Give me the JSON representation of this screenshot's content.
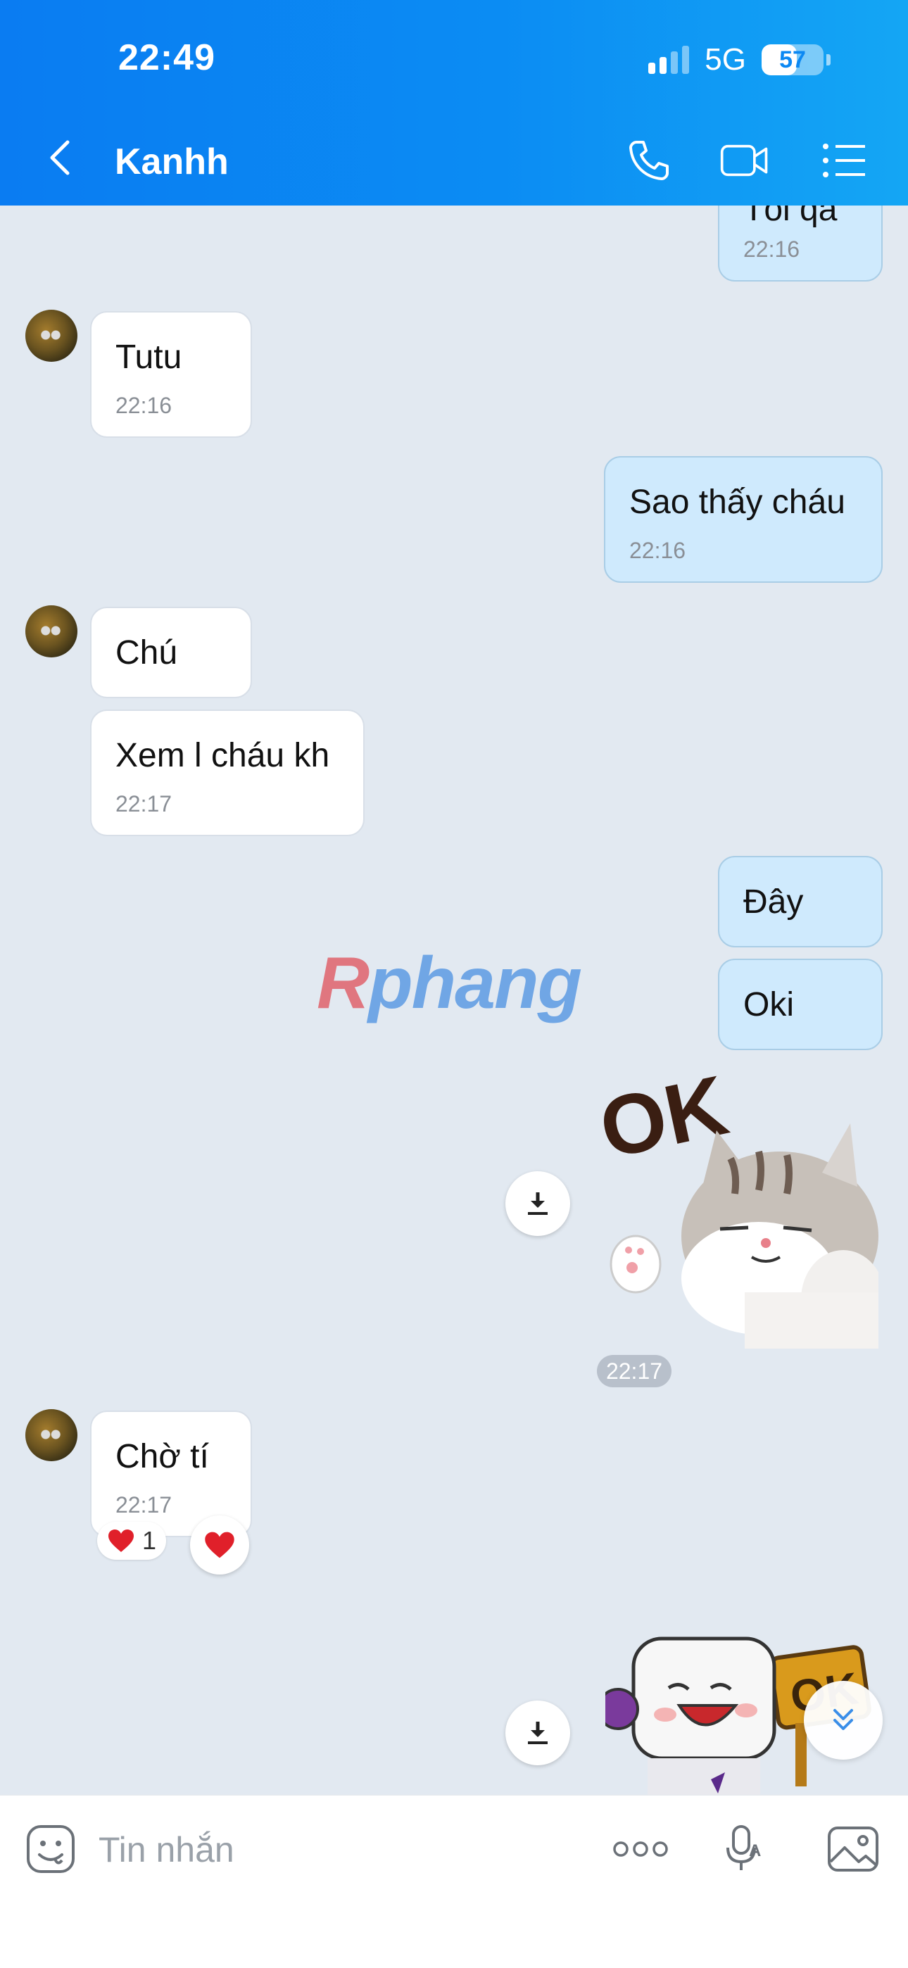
{
  "status_bar": {
    "time": "22:49",
    "network": "5G",
    "battery": "57",
    "battery_level": 0.57
  },
  "header": {
    "contact_name": "Kanhh",
    "icons": [
      "back-icon",
      "phone-icon",
      "video-call-icon",
      "menu-list-icon"
    ]
  },
  "messages": {
    "m0": {
      "text": "Tối qa",
      "time": "22:16"
    },
    "m1": {
      "text": "Tutu",
      "time": "22:16"
    },
    "m2": {
      "text": "Sao thấy cháu",
      "time": "22:16"
    },
    "m3": {
      "text": "Chú"
    },
    "m4": {
      "text": "Xem l cháu kh",
      "time": "22:17"
    },
    "m5": {
      "text": "Đây"
    },
    "m6": {
      "text": "Oki"
    },
    "sticker1": {
      "caption": "OK",
      "time": "22:17"
    },
    "m7": {
      "text": "Chờ tí",
      "time": "22:17",
      "reaction_count": "1"
    },
    "sticker2": {
      "caption": "OK"
    }
  },
  "watermark": {
    "first": "R",
    "rest": "phang"
  },
  "input": {
    "placeholder": "Tin nhắn",
    "value": ""
  },
  "colors": {
    "header": "#0b88f3",
    "background": "#e2e9f1",
    "outgoing_bubble": "#cfeafd",
    "incoming_bubble": "#ffffff",
    "heart": "#e0202a"
  }
}
